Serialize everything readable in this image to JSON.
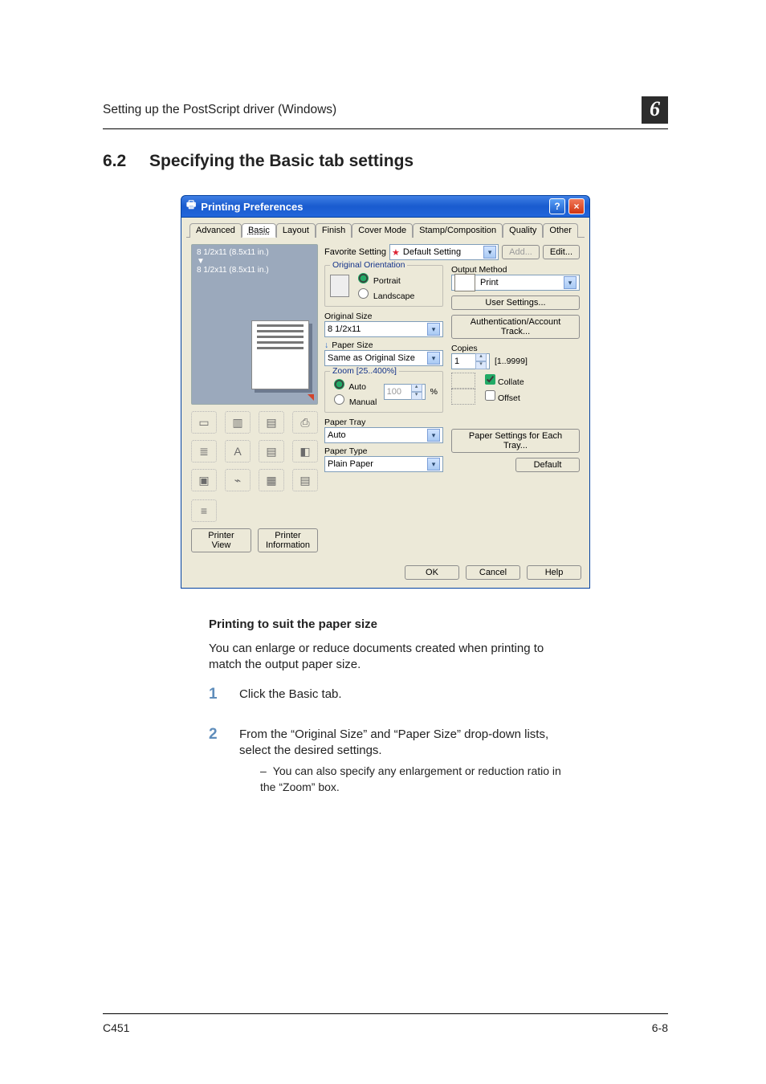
{
  "header": {
    "left": "Setting up the PostScript driver (Windows)",
    "chapter": "6"
  },
  "section": {
    "num": "6.2",
    "title": "Specifying the Basic tab settings"
  },
  "dialog": {
    "title": "Printing Preferences",
    "help_btn": "?",
    "close_btn": "×",
    "tabs": [
      "Advanced",
      "Basic",
      "Layout",
      "Finish",
      "Cover Mode",
      "Stamp/Composition",
      "Quality",
      "Other"
    ],
    "active_tab": "Basic",
    "preview": {
      "line1": "8 1/2x11 (8.5x11 in.)",
      "line2": "8 1/2x11 (8.5x11 in.)"
    },
    "left_buttons": {
      "printer_view": "Printer View",
      "printer_info": "Printer Information"
    },
    "favorite": {
      "label": "Favorite Setting",
      "value": "Default Setting",
      "add": "Add...",
      "edit": "Edit..."
    },
    "orientation": {
      "legend": "Original Orientation",
      "portrait": "Portrait",
      "landscape": "Landscape"
    },
    "original_size": {
      "label": "Original Size",
      "value": "8 1/2x11"
    },
    "paper_size": {
      "label": "Paper Size",
      "value": "Same as Original Size"
    },
    "zoom": {
      "legend": "Zoom [25..400%]",
      "auto": "Auto",
      "manual": "Manual",
      "value": "100",
      "pct": "%"
    },
    "paper_tray": {
      "label": "Paper Tray",
      "value": "Auto"
    },
    "paper_type": {
      "label": "Paper Type",
      "value": "Plain Paper"
    },
    "output": {
      "label": "Output Method",
      "value": "Print"
    },
    "user_settings": "User Settings...",
    "auth": "Authentication/Account Track...",
    "copies": {
      "label": "Copies",
      "value": "1",
      "range": "[1..9999]",
      "collate": "Collate",
      "offset": "Offset"
    },
    "paper_settings": "Paper Settings for Each Tray...",
    "default": "Default",
    "buttons": {
      "ok": "OK",
      "cancel": "Cancel",
      "help": "Help"
    }
  },
  "prose": {
    "subtitle": "Printing to suit the paper size",
    "para": "You can enlarge or reduce documents created when printing to match the output paper size.",
    "step1": "Click the Basic tab.",
    "step2": "From the “Original Size” and “Paper Size” drop-down lists, select the desired settings.",
    "step2_sub": "You can also specify any enlargement or reduction ratio in the “Zoom” box."
  },
  "footer": {
    "model": "C451",
    "pagenum": "6-8"
  }
}
